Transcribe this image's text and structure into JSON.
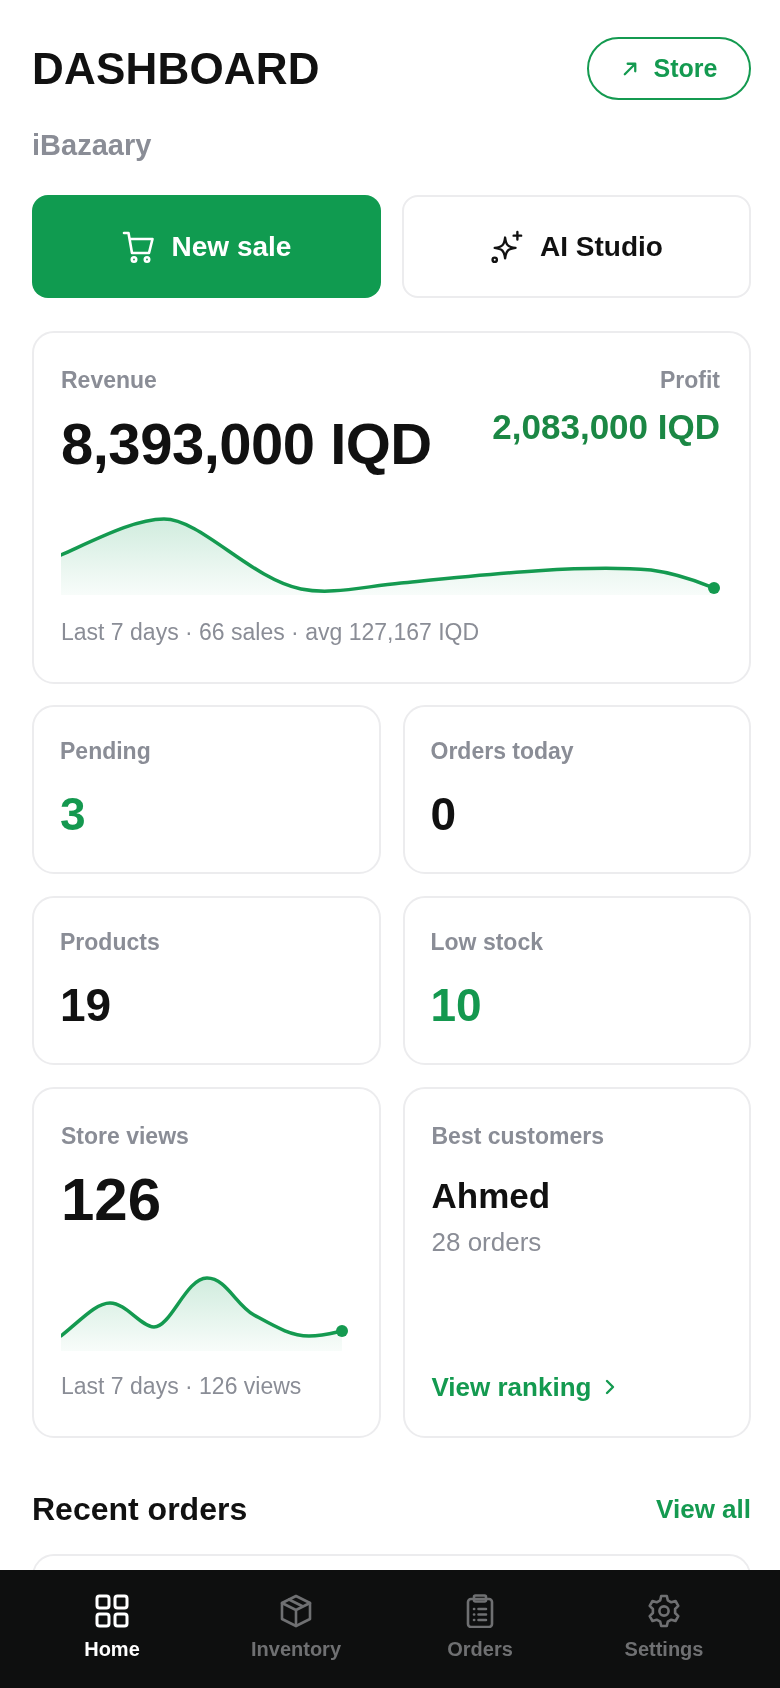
{
  "header": {
    "title": "DASHBOARD",
    "store_button": "Store",
    "subtitle": "iBazaary"
  },
  "actions": [
    {
      "label": "New sale",
      "kind": "primary"
    },
    {
      "label": "AI Studio",
      "kind": "secondary"
    }
  ],
  "revenue": {
    "label": "Revenue",
    "value": "8,393,000 IQD",
    "profit_label": "Profit",
    "profit_value": "2,083,000 IQD",
    "footnote": "Last 7 days · 66 sales · avg 127,167 IQD"
  },
  "stats": [
    {
      "label": "Pending",
      "value": "3",
      "color": "#14984f"
    },
    {
      "label": "Orders today",
      "value": "0",
      "color": "#111111"
    },
    {
      "label": "Products",
      "value": "19",
      "color": "#111111"
    },
    {
      "label": "Low stock",
      "value": "10",
      "color": "#14984f"
    }
  ],
  "store_views": {
    "label": "Store views",
    "value": "126",
    "footnote": "Last 7 days · 126 views"
  },
  "best_customers": {
    "label": "Best customers",
    "name": "Ahmed",
    "detail": "28 orders",
    "link": "View ranking"
  },
  "recent_orders": {
    "title": "Recent orders",
    "link": "View all"
  },
  "nav": [
    {
      "label": "Home",
      "selected": true
    },
    {
      "label": "Inventory",
      "selected": false
    },
    {
      "label": "Orders",
      "selected": false
    },
    {
      "label": "Settings",
      "selected": false
    }
  ]
}
